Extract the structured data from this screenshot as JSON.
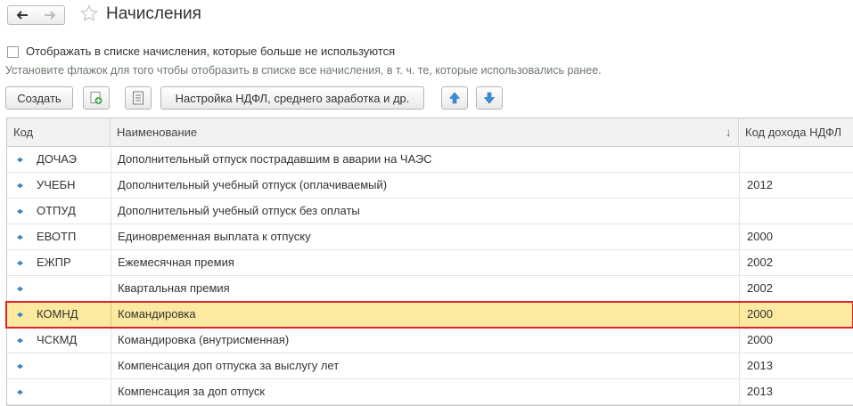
{
  "window": {
    "title": "Начисления",
    "back_icon": "arrow-left-icon",
    "forward_icon": "arrow-right-icon",
    "favorite_icon": "star-icon"
  },
  "filter": {
    "checkbox_label": "Отображать в списке начисления, которые больше не используются",
    "checked": false,
    "hint": "Установите флажок для того чтобы отобразить в списке все начисления, в т. ч. те, которые использовались ранее."
  },
  "toolbar": {
    "create_label": "Создать",
    "copy_icon": "add-copy-icon",
    "list_icon": "list-icon",
    "settings_label": "Настройка НДФЛ, среднего заработка и др.",
    "move_up_icon": "arrow-up-icon",
    "move_down_icon": "arrow-down-icon"
  },
  "table": {
    "columns": [
      "Код",
      "Наименование",
      "Код дохода НДФЛ"
    ],
    "sort_indicator": "↓",
    "rows": [
      {
        "code": "ДОЧАЭ",
        "name": "Дополнительный отпуск пострадавшим в аварии на ЧАЭС",
        "ndfl": ""
      },
      {
        "code": "УЧЕБН",
        "name": "Дополнительный учебный отпуск (оплачиваемый)",
        "ndfl": "2012"
      },
      {
        "code": "ОТПУД",
        "name": "Дополнительный учебный отпуск без оплаты",
        "ndfl": ""
      },
      {
        "code": "ЕВОТП",
        "name": "Единовременная выплата к отпуску",
        "ndfl": "2000"
      },
      {
        "code": "ЕЖПР",
        "name": "Ежемесячная премия",
        "ndfl": "2002"
      },
      {
        "code": "",
        "name": "Квартальная премия",
        "ndfl": "2002"
      },
      {
        "code": "КОМНД",
        "name": "Командировка",
        "ndfl": "2000",
        "selected": true
      },
      {
        "code": "ЧСКМД",
        "name": "Командировка (внутрисменная)",
        "ndfl": "2000"
      },
      {
        "code": "",
        "name": "Компенсация доп отпуска за выслугу лет",
        "ndfl": "2013"
      },
      {
        "code": "",
        "name": "Компенсация за доп отпуск",
        "ndfl": "2013"
      }
    ]
  },
  "colors": {
    "selected_row": "#fbeaa0",
    "highlight_border": "#e0202a",
    "row_marker": "#3b86c6",
    "arrow_button": "#3a8fd8"
  }
}
